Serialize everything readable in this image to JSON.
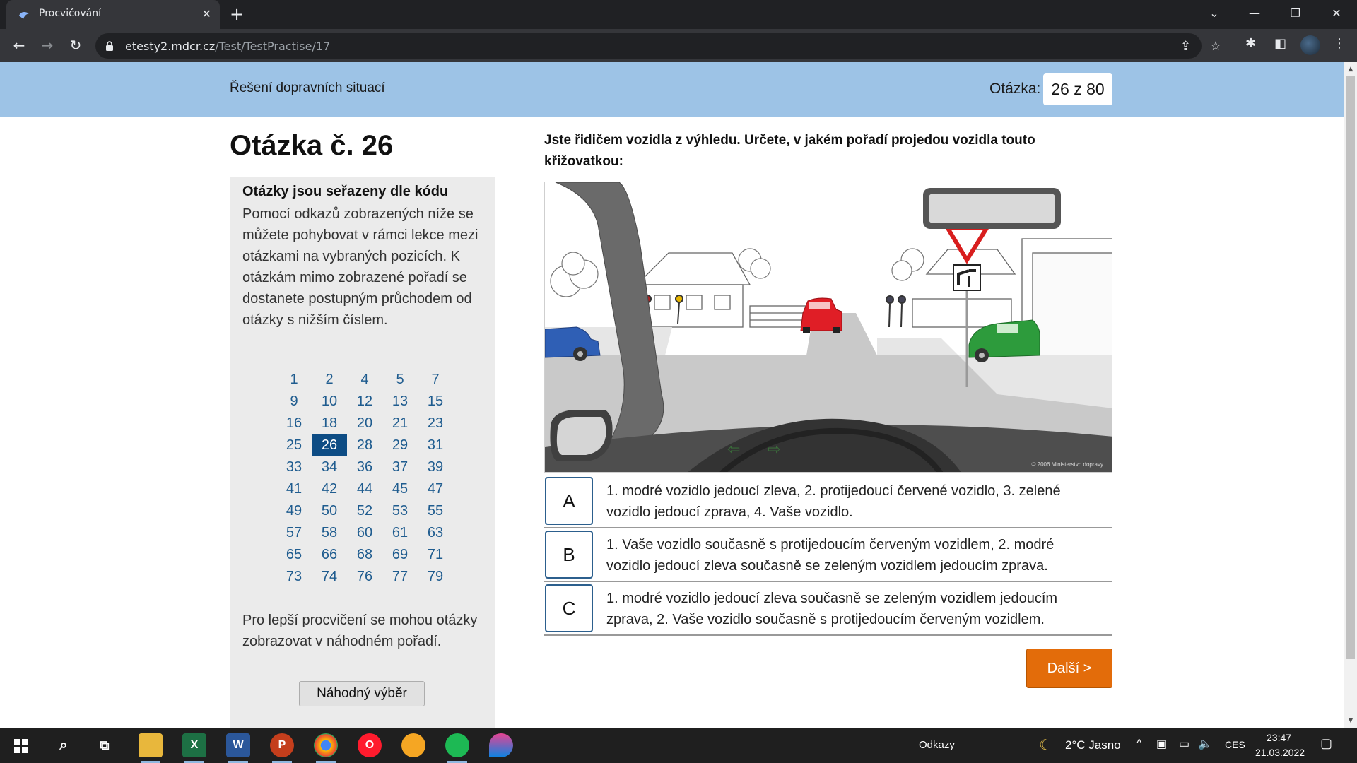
{
  "browser": {
    "tab_title": "Procvičování",
    "tab_close": "✕",
    "new_tab": "+",
    "url_host": "etesty2.mdcr.cz",
    "url_path": "/Test/TestPractise/17"
  },
  "header": {
    "section_title": "Řešení dopravních situací",
    "counter_label": "Otázka:",
    "counter_value": "26 z 80"
  },
  "main": {
    "question_heading": "Otázka č. 26",
    "question_text": "Jste řidičem vozidla z výhledu. Určete, v jakém pořadí projedou vozidla touto křižovatkou:",
    "image_copyright": "© 2006 Ministerstvo dopravy"
  },
  "sidebar": {
    "title": "Otázky jsou seřazeny dle kódu",
    "description": "Pomocí odkazů zobrazených níže se můžete pohybovat v rámci lekce mezi otázkami na vybraných pozicích. K otázkám mimo zobrazené pořadí se dostanete postupným průchodem od otázky s nižším číslem.",
    "question_numbers": [
      "1",
      "2",
      "4",
      "5",
      "7",
      "9",
      "10",
      "12",
      "13",
      "15",
      "16",
      "18",
      "20",
      "21",
      "23",
      "25",
      "26",
      "28",
      "29",
      "31",
      "33",
      "34",
      "36",
      "37",
      "39",
      "41",
      "42",
      "44",
      "45",
      "47",
      "49",
      "50",
      "52",
      "53",
      "55",
      "57",
      "58",
      "60",
      "61",
      "63",
      "65",
      "66",
      "68",
      "69",
      "71",
      "73",
      "74",
      "76",
      "77",
      "79"
    ],
    "active_number": "26",
    "random_note": "Pro lepší procvičení se mohou otázky zobrazovat v náhodném pořadí.",
    "random_button": "Náhodný výběr"
  },
  "answers": [
    {
      "letter": "A",
      "text": "1. modré vozidlo jedoucí zleva, 2. protijedoucí červené vozidlo, 3. zelené vozidlo jedoucí zprava, 4. Vaše vozidlo."
    },
    {
      "letter": "B",
      "text": "1. Vaše vozidlo současně s protijedoucím červeným vozidlem, 2. modré vozidlo jedoucí zleva současně se zeleným vozidlem jedoucím zprava."
    },
    {
      "letter": "C",
      "text": "1. modré vozidlo jedoucí zleva současně se zeleným vozidlem jedoucím zprava, 2. Vaše vozidlo současně s protijedoucím červeným vozidlem."
    }
  ],
  "next_button": "Další >",
  "taskbar": {
    "links_label": "Odkazy",
    "weather": "2°C  Jasno",
    "language": "CES",
    "time": "23:47",
    "date": "21.03.2022"
  },
  "colors": {
    "header_bg": "#9dc3e6",
    "active_link_bg": "#0d4c84",
    "link_color": "#1f5c8f",
    "next_button_bg": "#e36c0a",
    "answer_border": "#2c5f8d"
  }
}
